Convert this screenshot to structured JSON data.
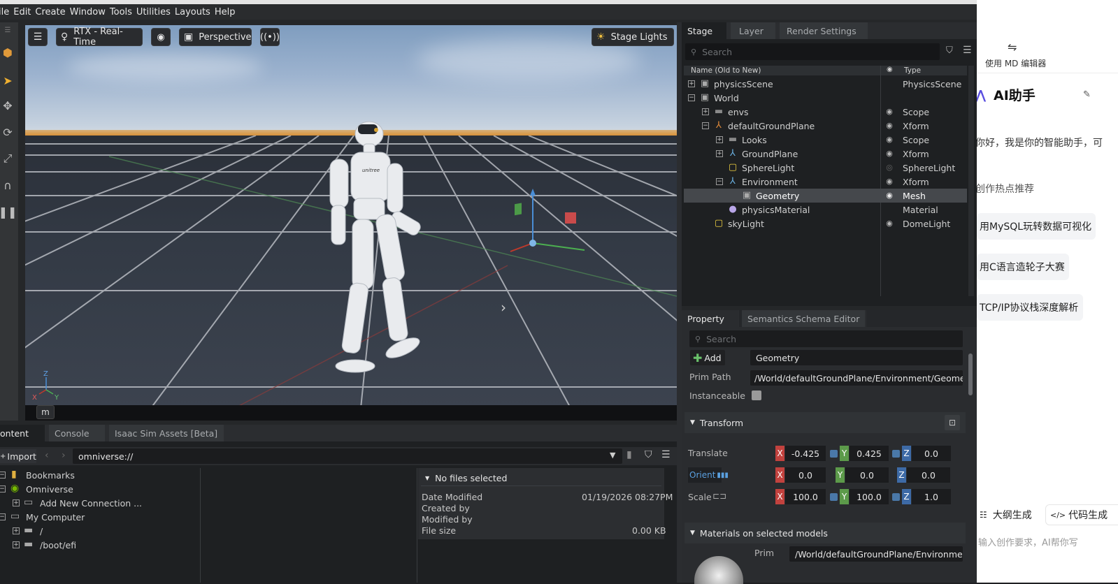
{
  "menubar": [
    "ile",
    "Edit",
    "Create",
    "Window",
    "Tools",
    "Utilities",
    "Layouts",
    "Help"
  ],
  "viewport": {
    "render_mode": "RTX - Real-Time",
    "camera": "Perspective",
    "lights": "Stage Lights",
    "units": "m",
    "axis_x": "X",
    "axis_y": "Y",
    "axis_z": "Z",
    "robot_logo": "unitree"
  },
  "stage": {
    "tabs": [
      "Stage",
      "Layer",
      "Render Settings"
    ],
    "search_placeholder": "Search",
    "col_name": "Name (Old to New)",
    "col_type": "Type",
    "rows": [
      {
        "name": "physicsScene",
        "type": "PhysicsScene"
      },
      {
        "name": "World",
        "type": ""
      },
      {
        "name": "envs",
        "type": "Scope"
      },
      {
        "name": "defaultGroundPlane",
        "type": "Xform"
      },
      {
        "name": "Looks",
        "type": "Scope"
      },
      {
        "name": "GroundPlane",
        "type": "Xform"
      },
      {
        "name": "SphereLight",
        "type": "SphereLight"
      },
      {
        "name": "Environment",
        "type": "Xform"
      },
      {
        "name": "Geometry",
        "type": "Mesh"
      },
      {
        "name": "physicsMaterial",
        "type": "Material"
      },
      {
        "name": "skyLight",
        "type": "DomeLight"
      }
    ]
  },
  "property": {
    "tabs": [
      "Property",
      "Semantics Schema Editor"
    ],
    "search_placeholder": "Search",
    "add_label": "Add",
    "name_value": "Geometry",
    "prim_path_label": "Prim Path",
    "prim_path_value": "/World/defaultGroundPlane/Environment/Geometry",
    "instanceable_label": "Instanceable",
    "transform_label": "Transform",
    "translate_label": "Translate",
    "orient_label": "Orient",
    "scale_label": "Scale",
    "translate": [
      "-0.425",
      "0.425",
      "0.0"
    ],
    "orient": [
      "0.0",
      "0.0",
      "0.0"
    ],
    "scale": [
      "100.0",
      "100.0",
      "1.0"
    ],
    "materials_label": "Materials on selected models",
    "mat_prim_label": "Prim",
    "mat_prim_value": "/World/defaultGroundPlane/Environment/"
  },
  "content": {
    "tabs": [
      "ontent",
      "Console",
      "Isaac Sim Assets [Beta]"
    ],
    "import_label": "Import",
    "path": "omniverse://",
    "tree": [
      "Bookmarks",
      "Omniverse",
      "Add New Connection ...",
      "My Computer",
      "/",
      "/boot/efi"
    ],
    "no_files": "No files selected",
    "date_modified_label": "Date Modified",
    "date_modified_value": "01/19/2026 08:27PM",
    "created_by_label": "Created by",
    "modified_by_label": "Modified by",
    "file_size_label": "File size",
    "file_size_value": "0.00 KB"
  },
  "ai_panel": {
    "md_editor": "使用 MD 编辑器",
    "title": "AI助手",
    "greeting": "你好，我是你的智能助手，可",
    "hot_label": "创作热点推荐",
    "suggestions": [
      "用MySQL玩转数据可视化",
      "用C语言造轮子大赛",
      "TCP/IP协议栈深度解析"
    ],
    "outline_btn": "大纲生成",
    "code_btn": "代码生成",
    "input_placeholder": "输入创作要求，AI帮你写"
  },
  "colors": {
    "axis_x": "#c2423e",
    "axis_y": "#5c9a4a",
    "axis_z": "#3d6aa6",
    "selected_row": "#45484c",
    "horizon": "#d98a2a",
    "ai_accent": "#5b4fe0"
  }
}
